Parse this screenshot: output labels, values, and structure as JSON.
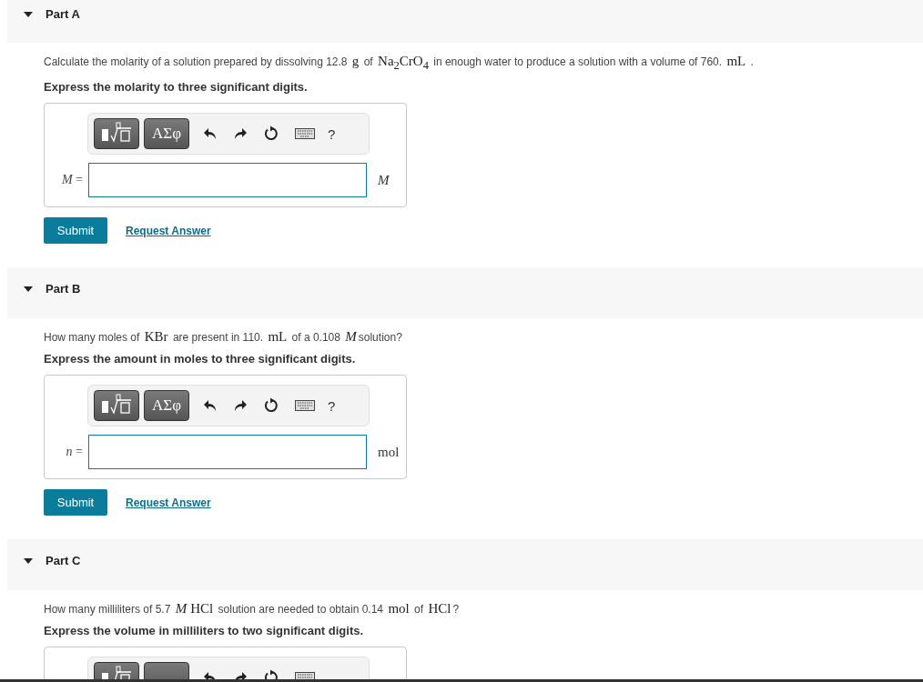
{
  "parts": [
    {
      "label": "Part A",
      "expanded": true,
      "question": [
        {
          "kind": "text",
          "text": "Calculate the molarity of a solution prepared by dissolving 12.8 "
        },
        {
          "kind": "math",
          "text": "g"
        },
        {
          "kind": "text",
          "text": " of "
        },
        {
          "kind": "math",
          "text": "Na$_{2}$CrO$_{4}$"
        },
        {
          "kind": "text",
          "text": " in enough water to produce a solution with a volume of 760. "
        },
        {
          "kind": "math",
          "text": "mL"
        },
        {
          "kind": "text",
          "text": " ."
        }
      ],
      "instruction": "Express the molarity to three significant digits.",
      "toolbar": {
        "symbols": "ΑΣφ",
        "help": "?"
      },
      "answer": {
        "variable": "*M* =",
        "unit": "*M*"
      },
      "submit": "Submit",
      "request": "Request Answer"
    },
    {
      "label": "Part B",
      "expanded": true,
      "question": [
        {
          "kind": "text",
          "text": "How many moles of "
        },
        {
          "kind": "math",
          "text": "KBr"
        },
        {
          "kind": "text",
          "text": " are present in 110. "
        },
        {
          "kind": "math",
          "text": "mL"
        },
        {
          "kind": "text",
          "text": " of a 0.108 "
        },
        {
          "kind": "math",
          "text": "*M*"
        },
        {
          "kind": "text",
          "text": "solution?"
        }
      ],
      "instruction": "Express the amount in moles to three significant digits.",
      "toolbar": {
        "symbols": "ΑΣφ",
        "help": "?"
      },
      "answer": {
        "variable": "*n* =",
        "unit": "mol"
      },
      "submit": "Submit",
      "request": "Request Answer"
    },
    {
      "label": "Part C",
      "expanded": true,
      "question": [
        {
          "kind": "text",
          "text": "How many milliliters of 5.7 "
        },
        {
          "kind": "math",
          "text": "*M*"
        },
        {
          "kind": "math",
          "text": "HCl"
        },
        {
          "kind": "text",
          "text": " solution are needed to obtain 0.14 "
        },
        {
          "kind": "math",
          "text": "mol"
        },
        {
          "kind": "text",
          "text": " of "
        },
        {
          "kind": "math",
          "text": "HCl"
        },
        {
          "kind": "text",
          "text": "?"
        }
      ],
      "instruction": "Express the volume in milliliters to two significant digits."
    }
  ]
}
